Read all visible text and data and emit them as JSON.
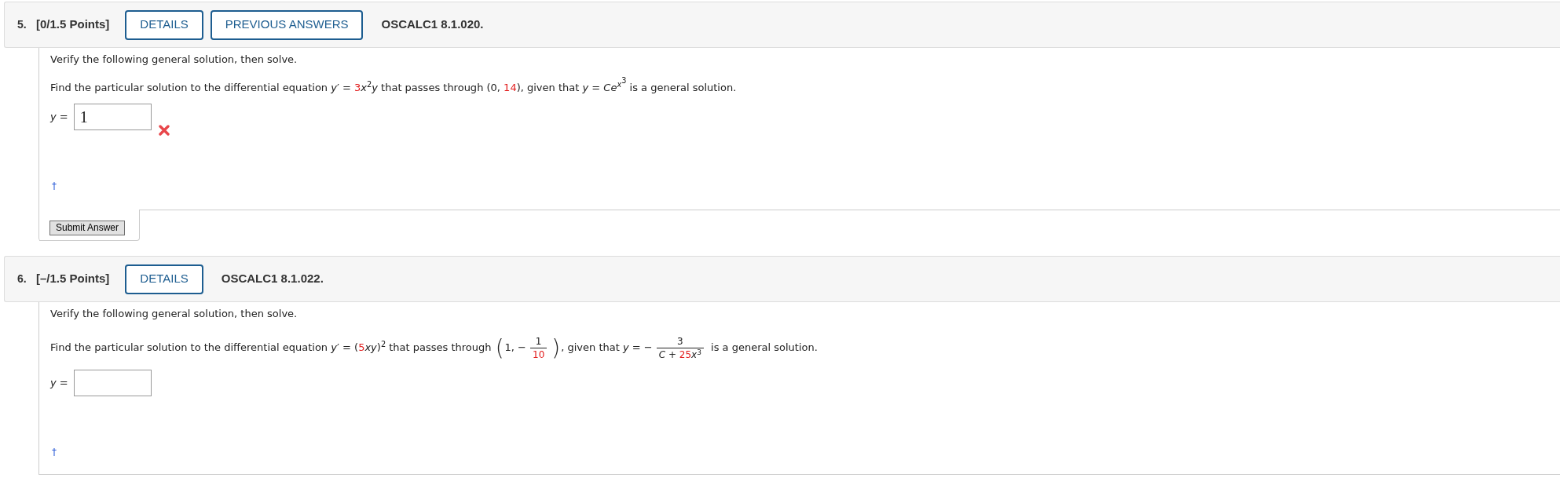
{
  "questions": [
    {
      "number": "5.",
      "points": "[0/1.5 Points]",
      "buttons": [
        "DETAILS",
        "PREVIOUS ANSWERS"
      ],
      "code": "OSCALC1 8.1.020.",
      "instruction": "Verify the following general solution, then solve.",
      "prompt": [
        {
          "kind": "text",
          "text": "Find the particular solution to the differential equation *y*′ = "
        },
        {
          "kind": "var",
          "text": "3"
        },
        {
          "kind": "text",
          "text": "*x*$^{2}$*y* that passes through (0, "
        },
        {
          "kind": "var",
          "text": "14"
        },
        {
          "kind": "text",
          "text": "), given that *y* = *Ce*"
        },
        {
          "kind": "italic",
          "text": "$^{x}$"
        },
        {
          "kind": "raised",
          "text": "$^{3}$"
        },
        {
          "kind": "text",
          "text": " is a general solution."
        }
      ],
      "answer": {
        "label": "*y* =",
        "value": "1",
        "correct": false
      },
      "footnote": "†",
      "submit": "Submit Answer"
    },
    {
      "number": "6.",
      "points": "[–/1.5 Points]",
      "buttons": [
        "DETAILS"
      ],
      "code": "OSCALC1 8.1.022.",
      "instruction": "Verify the following general solution, then solve.",
      "prompt": [
        {
          "kind": "text",
          "text": "Find the particular solution to the differential equation *y*′ = ("
        },
        {
          "kind": "var",
          "text": "5"
        },
        {
          "kind": "text",
          "text": "*xy*)$^{2}$ that passes through "
        },
        {
          "kind": "big",
          "text": "("
        },
        {
          "kind": "text",
          "text": "1, −"
        },
        {
          "kind": "frac",
          "numerator": [
            {
              "kind": "text",
              "text": "1"
            }
          ],
          "denominator": [
            {
              "kind": "var",
              "text": "10"
            }
          ]
        },
        {
          "kind": "big",
          "text": ")"
        },
        {
          "kind": "text",
          "text": ", given that *y* = −"
        },
        {
          "kind": "frac",
          "numerator": [
            {
              "kind": "text",
              "text": "3"
            }
          ],
          "denominator": [
            {
              "kind": "text",
              "text": "*C* + "
            },
            {
              "kind": "var",
              "text": "25"
            },
            {
              "kind": "text",
              "text": "*x*$^{3}$"
            }
          ]
        },
        {
          "kind": "text",
          "text": " is a general solution."
        }
      ],
      "answer": {
        "label": "*y* ="
      },
      "footnote": "†"
    }
  ]
}
